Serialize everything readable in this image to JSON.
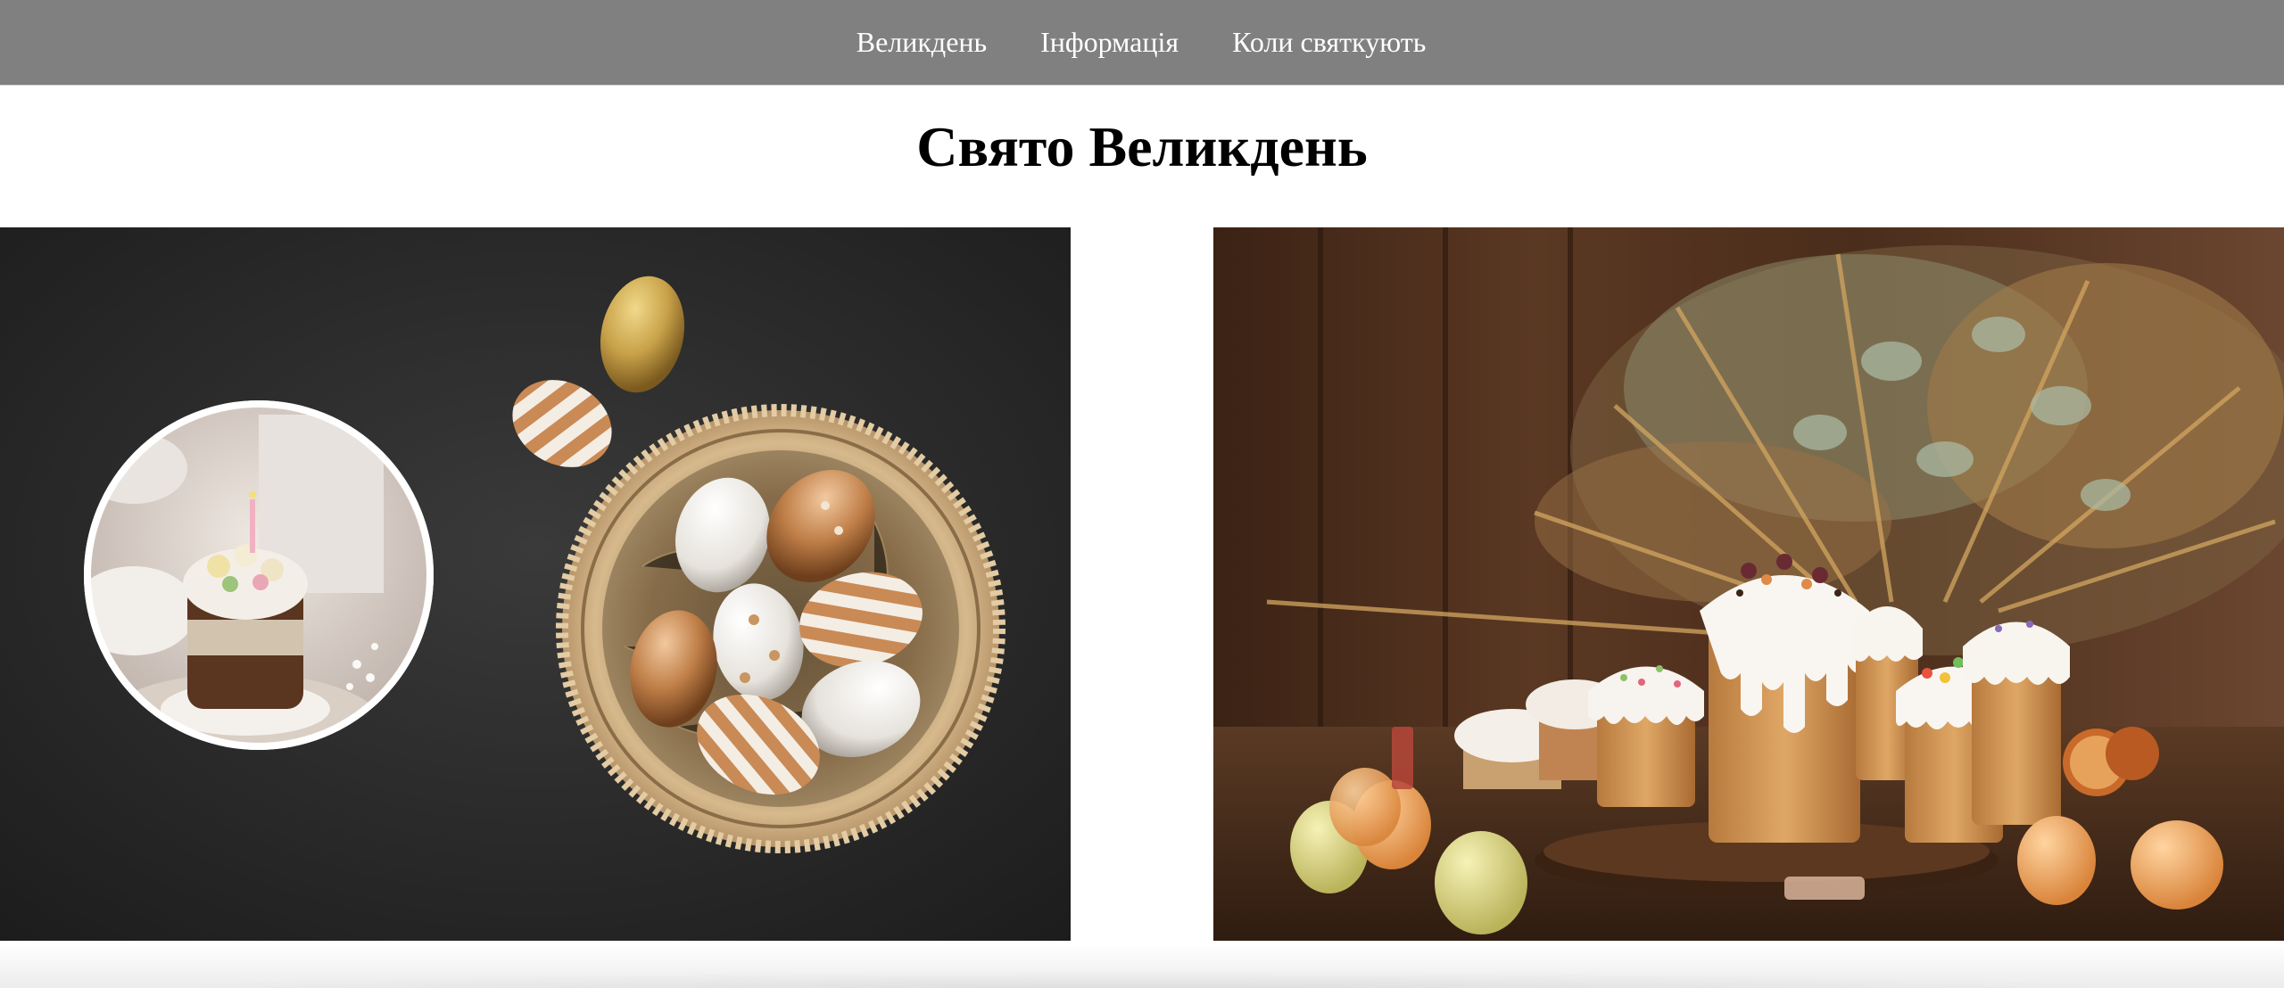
{
  "nav": {
    "items": [
      {
        "label": "Великдень"
      },
      {
        "label": "Інформація"
      },
      {
        "label": "Коли святкують"
      }
    ]
  },
  "page": {
    "title": "Свято Великдень"
  },
  "colors": {
    "nav_background": "#808080",
    "nav_text": "#ffffff",
    "title_text": "#000000"
  }
}
